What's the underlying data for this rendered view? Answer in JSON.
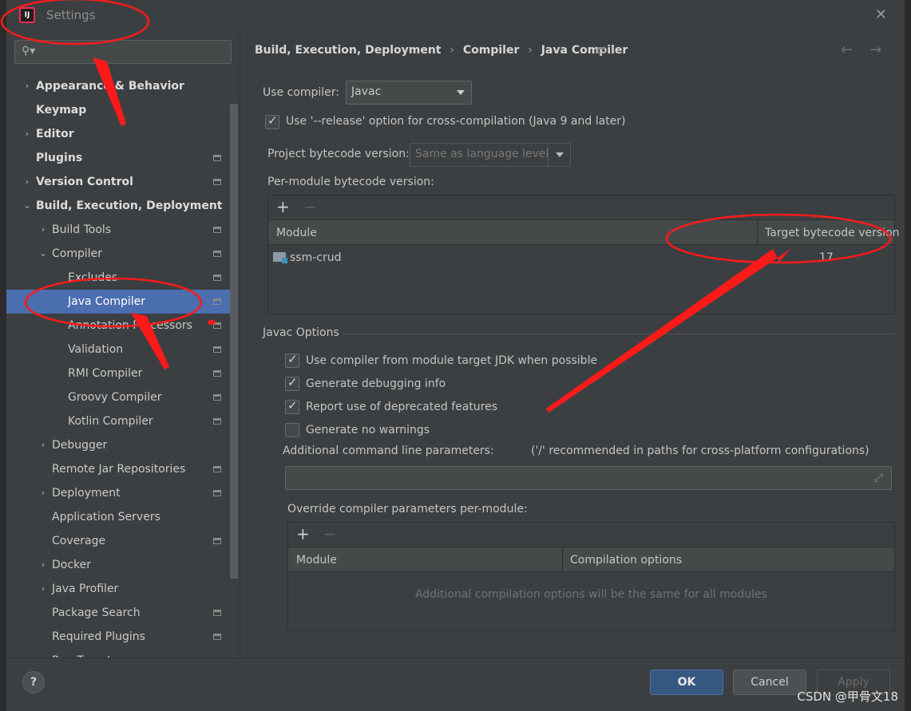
{
  "window": {
    "title": "Settings"
  },
  "search": {
    "placeholder": ""
  },
  "sidebar": {
    "items": [
      {
        "label": "Appearance & Behavior",
        "arrow": "›"
      },
      {
        "label": "Keymap"
      },
      {
        "label": "Editor",
        "arrow": "›"
      },
      {
        "label": "Plugins"
      },
      {
        "label": "Version Control",
        "arrow": "›"
      },
      {
        "label": "Build, Execution, Deployment",
        "arrow": "⌄"
      },
      {
        "label": "Build Tools",
        "arrow": "›"
      },
      {
        "label": "Compiler",
        "arrow": "⌄"
      },
      {
        "label": "Excludes"
      },
      {
        "label": "Java Compiler"
      },
      {
        "label": "Annotation Processors"
      },
      {
        "label": "Validation"
      },
      {
        "label": "RMI Compiler"
      },
      {
        "label": "Groovy Compiler"
      },
      {
        "label": "Kotlin Compiler"
      },
      {
        "label": "Debugger",
        "arrow": "›"
      },
      {
        "label": "Remote Jar Repositories"
      },
      {
        "label": "Deployment",
        "arrow": "›"
      },
      {
        "label": "Application Servers"
      },
      {
        "label": "Coverage"
      },
      {
        "label": "Docker",
        "arrow": "›"
      },
      {
        "label": "Java Profiler",
        "arrow": "›"
      },
      {
        "label": "Package Search"
      },
      {
        "label": "Required Plugins"
      },
      {
        "label": "Run Targets"
      }
    ]
  },
  "breadcrumb": {
    "items": [
      "Build, Execution, Deployment",
      "Compiler",
      "Java Compiler"
    ],
    "separator": "›"
  },
  "nav": {
    "back": "←",
    "forward": "→"
  },
  "compiler": {
    "use_compiler_label": "Use compiler:",
    "use_compiler_value": "Javac",
    "release_option_label": "Use '--release' option for cross-compilation (Java 9 and later)",
    "release_option_checked": true,
    "project_bytecode_label": "Project bytecode version:",
    "project_bytecode_value": "Same as language level",
    "per_module_label": "Per-module bytecode version:"
  },
  "module_table": {
    "add": "+",
    "remove": "−",
    "headers": [
      "Module",
      "Target bytecode version"
    ],
    "rows": [
      {
        "module": "ssm-crud",
        "version": "17"
      }
    ]
  },
  "javac": {
    "group_title": "Javac Options",
    "options": [
      {
        "label": "Use compiler from module target JDK when possible",
        "checked": true
      },
      {
        "label": "Generate debugging info",
        "checked": true
      },
      {
        "label": "Report use of deprecated features",
        "checked": true
      },
      {
        "label": "Generate no warnings",
        "checked": false
      }
    ],
    "additional_params_label": "Additional command line parameters:",
    "additional_params_hint": "('/' recommended in paths for cross-platform configurations)",
    "additional_params_value": "",
    "override_label": "Override compiler parameters per-module:"
  },
  "override_table": {
    "add": "+",
    "remove": "−",
    "headers": [
      "Module",
      "Compilation options"
    ],
    "empty_text": "Additional compilation options will be the same for all modules"
  },
  "buttons": {
    "help": "?",
    "ok": "OK",
    "cancel": "Cancel",
    "apply": "Apply"
  },
  "watermark": "CSDN @甲骨文18",
  "colors": {
    "selection": "#4b6eaf",
    "annotation": "#ff1a1a",
    "ok_button": "#365880"
  }
}
